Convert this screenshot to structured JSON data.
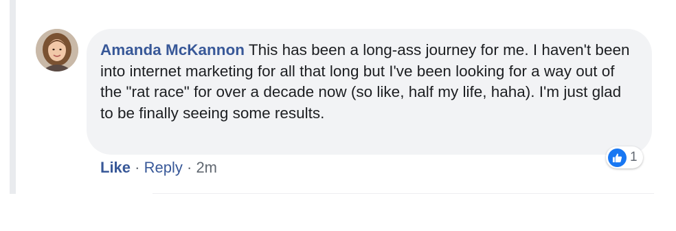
{
  "comment": {
    "author": "Amanda McKannon",
    "text": " This has been a long-ass journey for me. I haven't been into internet marketing for all that long but I've been looking for a way out of the \"rat race\" for over a decade now (so like, half my life, haha). I'm just glad to be finally seeing some results.",
    "avatar_icon": "user-avatar-photo",
    "reaction": {
      "icon": "thumbs-up-icon",
      "count": "1",
      "color": "#1877f2"
    },
    "actions": {
      "like_label": "Like",
      "separator": "·",
      "reply_label": "Reply",
      "timestamp": "2m"
    }
  },
  "colors": {
    "link": "#385898",
    "bubble": "#f2f3f5",
    "meta": "#606770"
  }
}
